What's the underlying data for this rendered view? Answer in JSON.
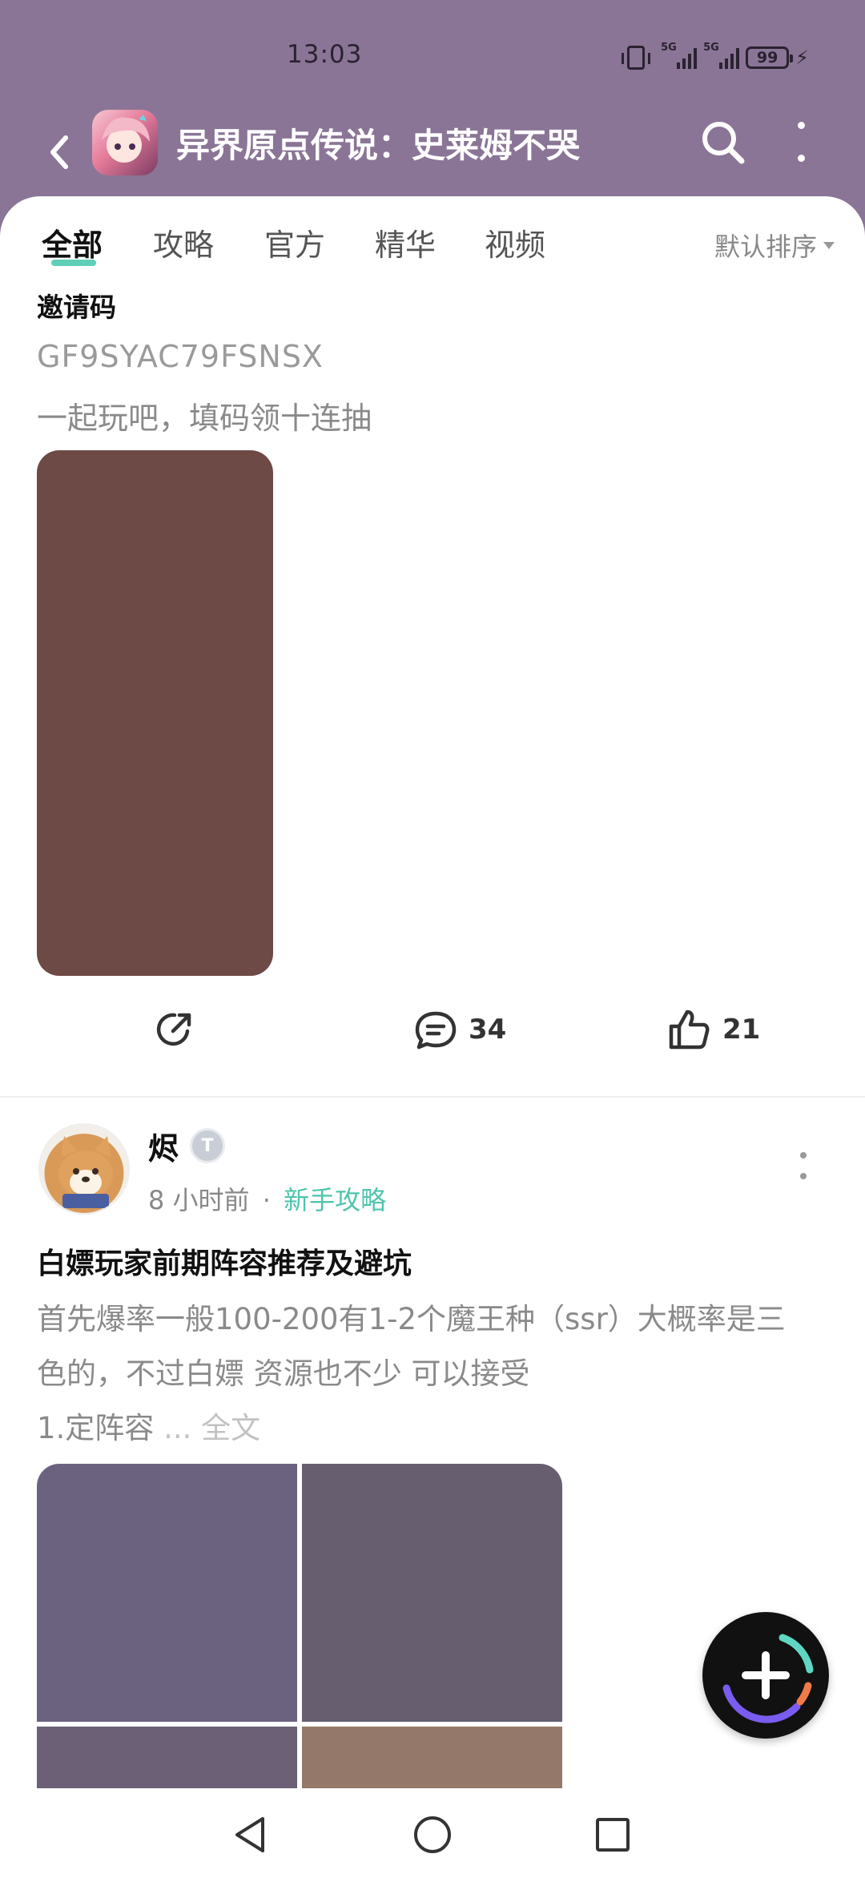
{
  "status_bar": {
    "time": "13:03",
    "network_1": "5G",
    "network_2": "5G",
    "battery": "99",
    "icons": [
      "vibrate-icon",
      "signal-icon",
      "battery-icon",
      "charging-icon"
    ]
  },
  "header": {
    "title": "异界原点传说：史莱姆不哭",
    "icons": [
      "back-arrow-icon",
      "search-icon",
      "more-vertical-icon"
    ]
  },
  "tabs": [
    {
      "label": "全部",
      "active": true
    },
    {
      "label": "攻略",
      "active": false
    },
    {
      "label": "官方",
      "active": false
    },
    {
      "label": "精华",
      "active": false
    },
    {
      "label": "视频",
      "active": false
    }
  ],
  "sort": {
    "label": "默认排序"
  },
  "post1": {
    "title": "邀请码",
    "code": "GF9SYAC79FSNSX",
    "text": "一起玩吧，填码领十连抽",
    "comment_count": "34",
    "like_count": "21",
    "image_color": "#6d4a46"
  },
  "post2": {
    "author": "烬",
    "badge": "T",
    "time": "8 小时前",
    "separator": "·",
    "category": "新手攻略",
    "title": "白嫖玩家前期阵容推荐及避坑",
    "body_line1": "首先爆率一般100-200有1-2个魔王种（ssr）大概率是三",
    "body_line2": "色的，不过白嫖 资源也不少 可以接受",
    "body_line3": "1.定阵容",
    "ellipsis": " ... ",
    "full_text": "全文",
    "image_colors": [
      "#6b6280",
      "#675f70",
      "#6b6075",
      "#94796a"
    ]
  },
  "colors": {
    "header_bg": "#8a7596",
    "accent": "#5fcfb9",
    "category": "#4ec4ad"
  }
}
